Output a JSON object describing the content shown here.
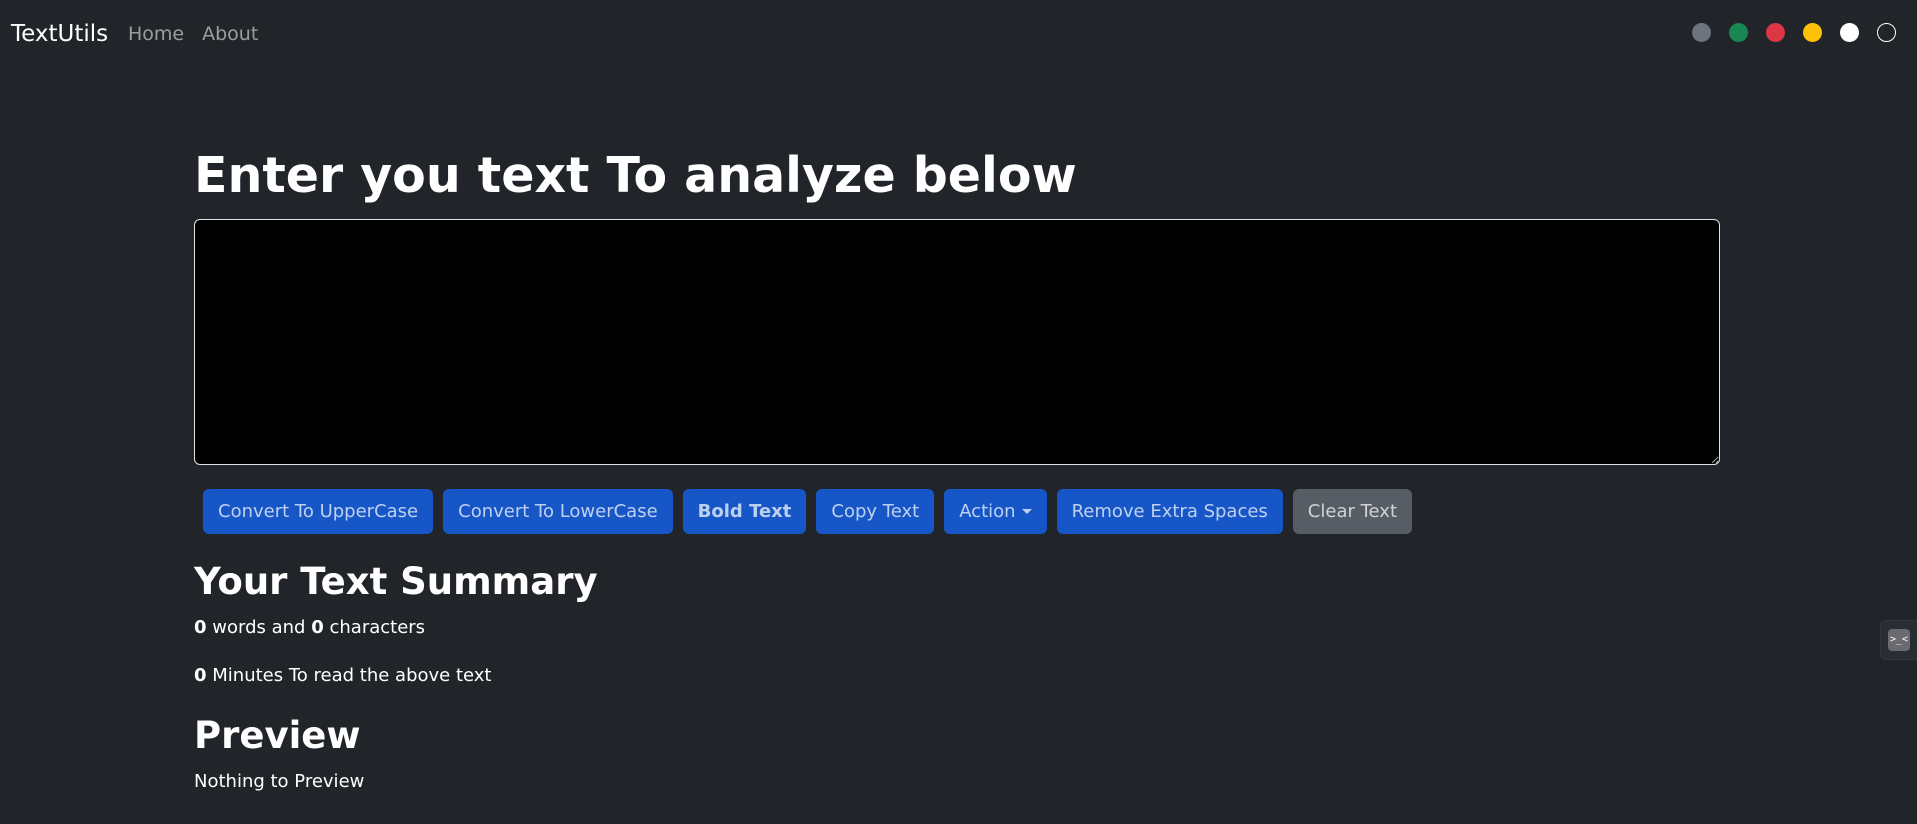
{
  "navbar": {
    "brand": "TextUtils",
    "links": [
      "Home",
      "About"
    ]
  },
  "theme_dots": [
    {
      "name": "gray",
      "color": "#6c757d"
    },
    {
      "name": "green",
      "color": "#198754"
    },
    {
      "name": "red",
      "color": "#dc3545"
    },
    {
      "name": "yellow",
      "color": "#ffc107"
    },
    {
      "name": "white",
      "color": "#ffffff"
    },
    {
      "name": "dark",
      "color": "#212529"
    }
  ],
  "main": {
    "heading": "Enter you text To analyze below",
    "textarea_value": "",
    "buttons": {
      "uppercase": "Convert To UpperCase",
      "lowercase": "Convert To LowerCase",
      "bold": "Bold Text",
      "copy": "Copy Text",
      "action": "Action",
      "remove_spaces": "Remove Extra Spaces",
      "clear": "Clear Text"
    }
  },
  "summary": {
    "title": "Your Text Summary",
    "word_count": "0",
    "words_and": "words and",
    "char_count": "0",
    "characters": "characters",
    "minutes": "0",
    "minutes_text": "Minutes To read the above text"
  },
  "preview": {
    "title": "Preview",
    "text": "Nothing to Preview"
  },
  "colors": {
    "background": "#212529",
    "primary_button": "#1656c7",
    "secondary_button": "#565d64"
  },
  "side_widget": {
    "icon": "extension-icon",
    "glyph": ">_<"
  }
}
